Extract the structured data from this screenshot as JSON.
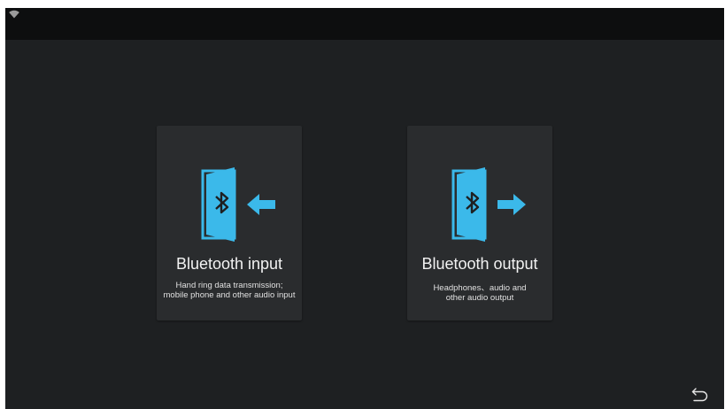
{
  "status_bar": {
    "wifi_icon": "wifi-icon"
  },
  "cards": {
    "input": {
      "title": "Bluetooth input",
      "desc_line1": "Hand ring data transmission;",
      "desc_line2": "mobile phone and other audio input",
      "icon": "bluetooth-input-icon"
    },
    "output": {
      "title": "Bluetooth output",
      "desc_line1": "Headphones、audio and",
      "desc_line2": "other audio output",
      "icon": "bluetooth-output-icon"
    }
  },
  "back_icon": "back-arrow-icon",
  "colors": {
    "accent": "#3bb9ea",
    "background": "#1e2022",
    "card": "#2a2c2e",
    "status_bar": "#0d0e0f"
  }
}
